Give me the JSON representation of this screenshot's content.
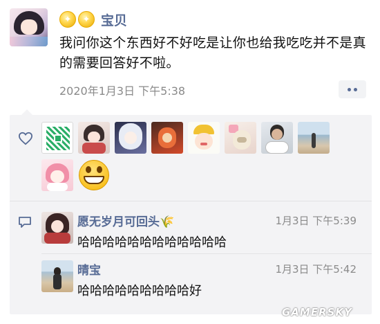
{
  "post": {
    "author": "宝贝",
    "badges": [
      "gold-badge-icon",
      "gold-badge-icon"
    ],
    "text": "我问你这个东西好不好吃是让你也给我吃吃并不是真的需要回答好不啦。",
    "time": "2020年1月3日 下午5:38"
  },
  "likes": {
    "icon": "heart-icon",
    "likers": [
      "liker-1",
      "liker-2",
      "liker-3",
      "liker-4",
      "liker-5",
      "liker-6",
      "liker-7",
      "liker-8",
      "liker-9",
      "liker-10"
    ]
  },
  "comments": [
    {
      "author": "愿无岁月可回头🌾",
      "time": "1月3日 下午5:39",
      "text": "哈哈哈哈哈哈哈哈哈哈哈哈"
    },
    {
      "author": "晴宝",
      "time": "1月3日 下午5:42",
      "text": "哈哈哈哈哈哈哈哈哈好"
    }
  ],
  "watermark": "GAMERSKY",
  "colors": {
    "link": "#576b95",
    "panel": "#f3f3f5",
    "time": "#8a8a8a"
  }
}
